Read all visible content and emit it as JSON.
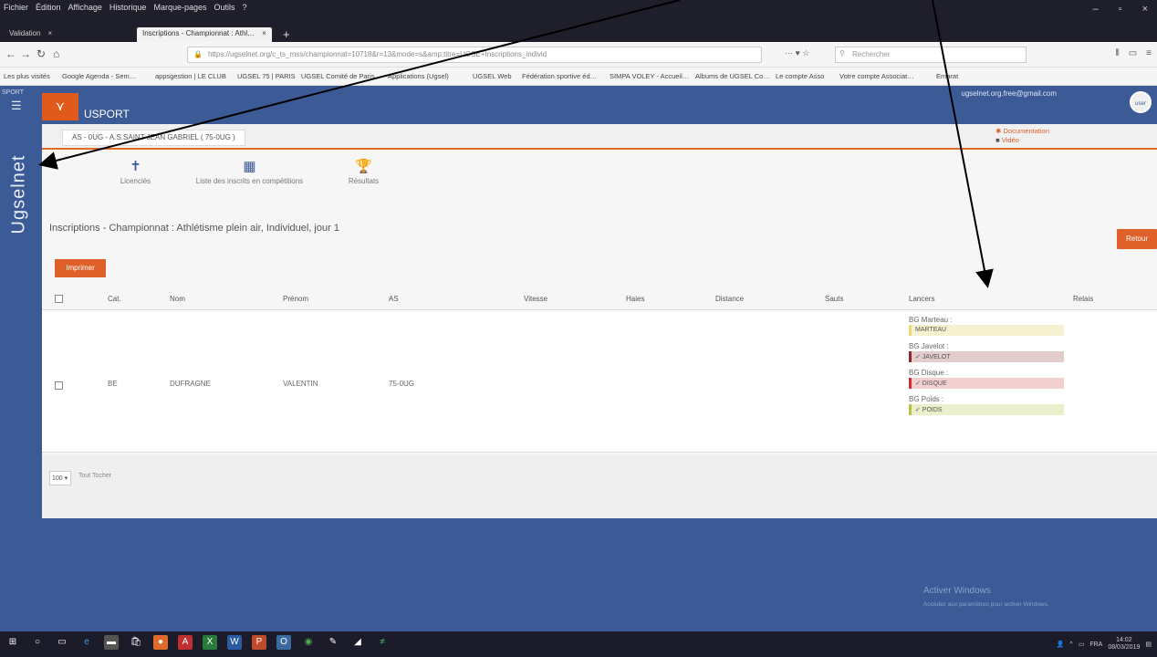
{
  "browser": {
    "menu": [
      "Fichier",
      "Édition",
      "Affichage",
      "Historique",
      "Marque-pages",
      "Outils",
      "?"
    ],
    "tabs": [
      {
        "label": "Validation"
      },
      {
        "label": "Inscriptions - Championnat : Athl…"
      }
    ],
    "url": "https://ugselnet.org/c_ts_rnss/championnat=10718&r=13&mode=s&amp;titre=UGSE+Inscriptions_individ",
    "search_placeholder": "Rechercher",
    "bookmarks": [
      "Les plus visités",
      "Google Agenda - Sem…",
      "appsgestion | LE CLUB",
      "UGSEL 75 | PARIS",
      "UGSEL Comité de Paris",
      "Applications (Ugsel)",
      "UGSEL Web",
      "Fédération sportive éd…",
      "SIMPA VOLEY - Accueil…",
      "Albums de UGSEL Co…",
      "Le compte Asso",
      "Votre compte Associat…",
      "Emarat"
    ]
  },
  "sidebar": {
    "top_label": "SPORT",
    "vertical_label": "Ugselnet"
  },
  "header": {
    "brand": "USPORT",
    "user_email": "ugselnet.org.free@gmail.com",
    "avatar_text": "user"
  },
  "breadcrumb": "AS - 0UG - A.S.SAINT JEAN GABRIEL ( 75-0UG )",
  "doc_links": [
    "Documentation",
    "Vidéo"
  ],
  "quicklinks": [
    {
      "icon": "licence-icon",
      "label": "Licenciés"
    },
    {
      "icon": "calendar-icon",
      "label": "Liste des inscrits en compétitions"
    },
    {
      "icon": "trophy-icon",
      "label": "Résultats"
    }
  ],
  "page_title": "Inscriptions - Championnat : Athlétisme plein air, Individuel, jour 1",
  "buttons": {
    "retour": "Retour",
    "imprimer": "Imprimer"
  },
  "table": {
    "headers": [
      "Cat.",
      "Nom",
      "Prénom",
      "AS",
      "Vitesse",
      "Haies",
      "Distance",
      "Sauts",
      "Lancers",
      "Relais"
    ],
    "row": {
      "cat": "BE",
      "nom": "DUFRAGNE",
      "prenom": "VALENTIN",
      "as": "75-0UG",
      "lancers": [
        {
          "label": "BG Marteau :",
          "value": "MARTEAU",
          "color": "#e8d87a",
          "bg": "#f6f1d0"
        },
        {
          "label": "BG Javelot :",
          "value": "✓ JAVELOT",
          "color": "#8a2a2a",
          "bg": "#e2cccc"
        },
        {
          "label": "BG Disque :",
          "value": "✓ DISQUE",
          "color": "#cc3030",
          "bg": "#f3cfcf"
        },
        {
          "label": "BG Poids :",
          "value": "✓ POIDS",
          "color": "#b8c040",
          "bg": "#ecefcc"
        }
      ]
    }
  },
  "footer": {
    "perpage": "100 ▾",
    "tout": "Tout Tocher"
  },
  "watermark": {
    "title": "Activer Windows",
    "sub": "Accédez aux paramètres pour activer Windows."
  },
  "tray": {
    "lang": "FRA",
    "time": "14:02",
    "date": "08/03/2019"
  }
}
